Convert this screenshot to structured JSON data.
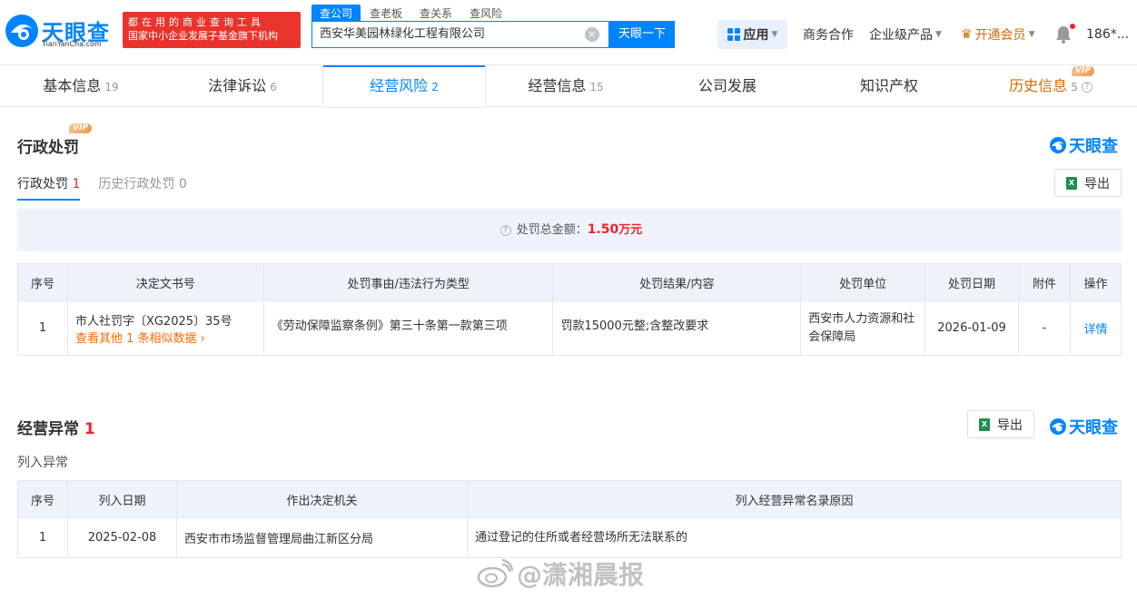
{
  "header": {
    "logo_cn": "天眼查",
    "logo_en": "TianYanCha.com",
    "slogan_line1": "都在用的商业查询工具",
    "slogan_line2": "国家中小企业发展子基金旗下机构",
    "search_tabs": [
      "查公司",
      "查老板",
      "查关系",
      "查风险"
    ],
    "search_value": "西安华美园林绿化工程有限公司",
    "search_button": "天眼一下",
    "apps": "应用",
    "business": "商务合作",
    "enterprise": "企业级产品",
    "vip": "开通会员",
    "user": "186*..."
  },
  "tabs": [
    {
      "label": "基本信息",
      "count": "19"
    },
    {
      "label": "法律诉讼",
      "count": "6"
    },
    {
      "label": "经营风险",
      "count": "2"
    },
    {
      "label": "经营信息",
      "count": "15"
    },
    {
      "label": "公司发展",
      "count": ""
    },
    {
      "label": "知识产权",
      "count": ""
    },
    {
      "label": "历史信息",
      "count": "5"
    }
  ],
  "vip_label": "VIP",
  "brand": "天眼查",
  "penalty": {
    "title": "行政处罚",
    "subtabs": [
      {
        "label": "行政处罚",
        "count": "1"
      },
      {
        "label": "历史行政处罚",
        "count": "0"
      }
    ],
    "export": "导出",
    "summary_label": "处罚总金额：",
    "summary_amount": "1.50",
    "summary_unit": "万元",
    "columns": [
      "序号",
      "决定文书号",
      "处罚事由/违法行为类型",
      "处罚结果/内容",
      "处罚单位",
      "处罚日期",
      "附件",
      "操作"
    ],
    "rows": [
      {
        "no": "1",
        "doc": "市人社罚字〔XG2025〕35号",
        "similar": "查看其他 1 条相似数据",
        "reason": "《劳动保障监察条例》第三十条第一款第三项",
        "result": "罚款15000元整;含整改要求",
        "unit": "西安市人力资源和社会保障局",
        "date": "2026-01-09",
        "attachment": "-",
        "action": "详情"
      }
    ]
  },
  "abnormal": {
    "title": "经营异常",
    "count": "1",
    "export": "导出",
    "list_label": "列入异常",
    "columns": [
      "序号",
      "列入日期",
      "作出决定机关",
      "列入经营异常名录原因"
    ],
    "rows": [
      {
        "no": "1",
        "date": "2025-02-08",
        "authority": "西安市市场监督管理局曲江新区分局",
        "reason": "通过登记的住所或者经营场所无法联系的"
      }
    ]
  },
  "watermark": "@潇湘晨报",
  "colors": {
    "primary": "#0084ff",
    "danger": "#f5222d",
    "vip": "#d46b08"
  }
}
